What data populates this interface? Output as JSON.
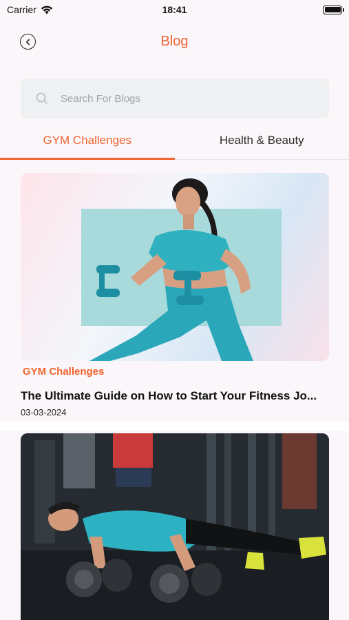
{
  "status_bar": {
    "carrier": "Carrier",
    "time": "18:41"
  },
  "header": {
    "title": "Blog"
  },
  "search": {
    "placeholder": "Search For Blogs",
    "value": ""
  },
  "tabs": [
    {
      "label": "GYM Challenges",
      "active": true
    },
    {
      "label": "Health & Beauty",
      "active": false
    }
  ],
  "posts": [
    {
      "category": "GYM Challenges",
      "title": "The Ultimate Guide on How to Start Your Fitness Jo...",
      "date": "03-03-2024",
      "image": "woman-with-dumbbells-photo"
    },
    {
      "image": "man-pushup-on-dumbbells-photo"
    }
  ],
  "colors": {
    "accent": "#f0642f",
    "search_bg": "#eef0f1",
    "page_bg": "#fbf6f9",
    "teal_outfit": "#2fb1c0"
  }
}
